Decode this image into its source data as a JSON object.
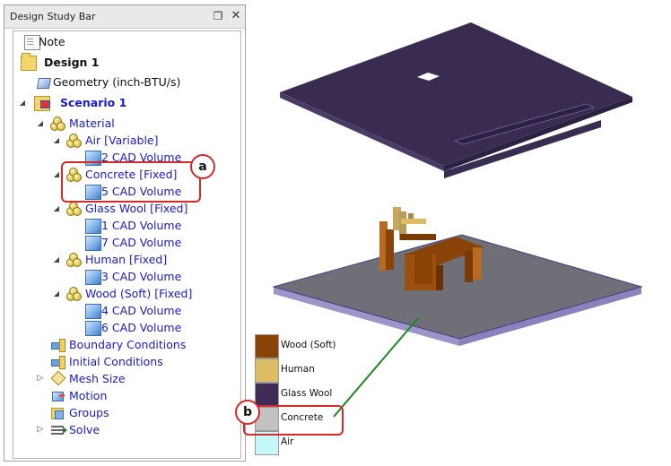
{
  "panel": {
    "title": "Design Study Bar",
    "pin_glyph": "❐",
    "close_glyph": "✕"
  },
  "tree": {
    "note": "Note",
    "design": "Design 1",
    "geometry": "Geometry (inch-BTU/s)",
    "scenario": "Scenario 1",
    "material": "Material",
    "air": "Air [Variable]",
    "air_vol": "2 CAD Volume",
    "concrete": "Concrete [Fixed]",
    "concrete_vol": "5 CAD Volume",
    "glass_wool": "Glass Wool [Fixed]",
    "glass_wool_vol1": "1 CAD Volume",
    "glass_wool_vol2": "7 CAD Volume",
    "human": "Human [Fixed]",
    "human_vol": "3 CAD Volume",
    "wood": "Wood (Soft) [Fixed]",
    "wood_vol1": "4 CAD Volume",
    "wood_vol2": "6 CAD Volume",
    "boundary": "Boundary Conditions",
    "initial": "Initial Conditions",
    "mesh": "Mesh Size",
    "motion": "Motion",
    "groups": "Groups",
    "solve": "Solve"
  },
  "callouts": {
    "a": "a",
    "b": "b"
  },
  "legend": [
    {
      "label": "Wood (Soft)",
      "color": "#8a4306"
    },
    {
      "label": "Human",
      "color": "#dcbc62"
    },
    {
      "label": "Glass Wool",
      "color": "#3f2b55"
    },
    {
      "label": "Concrete",
      "color": "#c2c2c2"
    },
    {
      "label": "Air",
      "color": "#c4f7f7"
    }
  ],
  "colors": {
    "callout": "#d42a2a",
    "leader_line": "#1e8a1e",
    "tree_link": "#1a1acc"
  }
}
